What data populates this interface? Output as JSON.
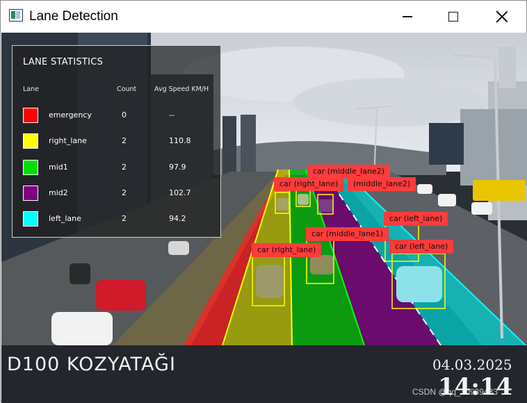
{
  "window": {
    "title": "Lane Detection",
    "controls": {
      "minimize": "minimize",
      "maximize": "maximize",
      "close": "close"
    }
  },
  "stats": {
    "title": "LANE STATISTICS",
    "headers": {
      "lane": "Lane",
      "count": "Count",
      "speed": "Avg Speed KM/H"
    },
    "rows": [
      {
        "lane": "emergency",
        "count": "0",
        "speed": "--",
        "color": "#ff0000"
      },
      {
        "lane": "right_lane",
        "count": "2",
        "speed": "110.8",
        "color": "#ffff00"
      },
      {
        "lane": "mid1",
        "count": "2",
        "speed": "97.9",
        "color": "#00e000"
      },
      {
        "lane": "mid2",
        "count": "2",
        "speed": "102.7",
        "color": "#800080"
      },
      {
        "lane": "left_lane",
        "count": "2",
        "speed": "94.2",
        "color": "#00ffff"
      }
    ]
  },
  "detections": [
    {
      "label": "car (middle_lane2)"
    },
    {
      "label": "car (right_lane)"
    },
    {
      "label": "(middle_lane2)"
    },
    {
      "label": "car (left_lane)"
    },
    {
      "label": "car (middle_lane1)"
    },
    {
      "label": "car (left_lane)"
    },
    {
      "label": "car (right_lane)"
    }
  ],
  "overlay": {
    "location": "D100 KOZYATAĞI",
    "date": "04.03.2025",
    "time": "14:14"
  },
  "watermark": "CSDN @qq_30939433",
  "colors": {
    "emergency": "#ff0000",
    "right_lane": "#ffff00",
    "mid1": "#00e000",
    "mid2": "#800080",
    "left_lane": "#00ffff",
    "label_bg": "#ff3b3b"
  }
}
